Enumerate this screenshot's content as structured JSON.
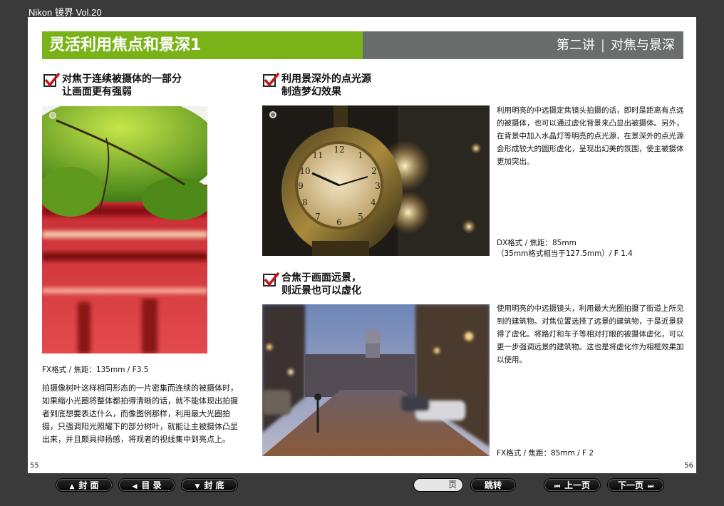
{
  "app": {
    "title": "Nikon 镜界 Vol.20"
  },
  "header": {
    "title": "灵活利用焦点和景深1",
    "lecture": "第二讲",
    "topic": "对焦与景深"
  },
  "left": {
    "section_title": "对焦于连续被摄体的一部分\n让画面更有强弱",
    "caption": "FX格式 / 焦距：135mm / F3.5",
    "body": "拍摄像树叶这样相同形态的一片密集而连续的被摄体时，如果缩小光圈将整体都拍得清晰的话，就不能体现出拍摄者到底想要表达什么，而像图例那样，利用最大光圈拍摄，只强调阳光照耀下的部分树叶，就能让主被摄体凸显出来，并且颇具抑扬感，将观者的视线集中到亮点上。"
  },
  "right_top": {
    "section_title": "利用景深外的点光源\n制造梦幻效果",
    "body": "利用明亮的中远摄定焦镜头拍摄的话，即时是距离有点远的被摄体，也可以通过虚化背景来凸显出被摄体。另外，在背景中加入水晶灯等明亮的点光源，在景深外的点光源会形成较大的圆形虚化，呈现出幻美的氛围，使主被摄体更加突出。",
    "caption": "DX格式 / 焦距：85mm\n（35mm格式相当于127.5mm）/ F 1.4"
  },
  "right_bottom": {
    "section_title": "合焦于画面远景，\n则近景也可以虚化",
    "body": "使用明亮的中远摄镜头，利用最大光圈拍摄了街道上所见到的建筑物。对焦位置选择了远景的建筑物，于是近景获得了虚化。将路灯和车子等相对打眼的被摄体虚化，可以更一步强调远景的建筑物。这也是将虚化作为相框效果加以使用。",
    "caption": "FX格式 / 焦距：85mm / F 2"
  },
  "pages": {
    "left": "55",
    "right": "56"
  },
  "toolbar": {
    "cover": "封 面",
    "toc": "目 录",
    "back_cover": "封 底",
    "page_suffix": "页",
    "jump": "跳转",
    "prev": "上一页",
    "next": "下一页"
  },
  "colors": {
    "accent_green": "#7ab317",
    "header_gray": "#6a6d6b",
    "check_red": "#c0141c"
  }
}
